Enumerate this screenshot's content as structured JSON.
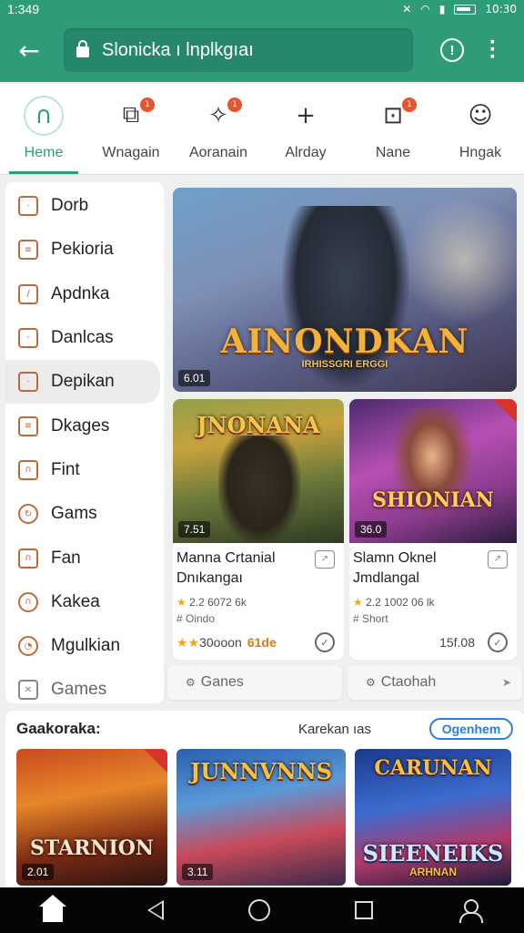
{
  "status_bar": {
    "time_left": "1:349",
    "time_right": "10:30"
  },
  "app_bar": {
    "url_text": "Slonicka ı lnplkgıaı"
  },
  "tabs": [
    {
      "label": "Heme",
      "icon": "headphones-icon",
      "glyph": "∩",
      "badge": ""
    },
    {
      "label": "Wnagain",
      "icon": "pages-icon",
      "glyph": "⧉",
      "badge": "1"
    },
    {
      "label": "Aoranain",
      "icon": "star-icon",
      "glyph": "✧",
      "badge": "1"
    },
    {
      "label": "Alrday",
      "icon": "plus-icon",
      "glyph": "+",
      "badge": ""
    },
    {
      "label": "Nane",
      "icon": "bag-icon",
      "glyph": "⊡",
      "badge": "1"
    },
    {
      "label": "Hngak",
      "icon": "person-icon",
      "glyph": "☺",
      "badge": ""
    }
  ],
  "sidebar": {
    "items": [
      {
        "label": "Dorb",
        "icon": "square-icon",
        "glyph": "·"
      },
      {
        "label": "Pekioria",
        "icon": "layers-icon",
        "glyph": "≡"
      },
      {
        "label": "Apdnka",
        "icon": "pencil-icon",
        "glyph": "/"
      },
      {
        "label": "Danlcas",
        "icon": "smile-icon",
        "glyph": "ᵕ"
      },
      {
        "label": "Depikan",
        "icon": "box-icon",
        "glyph": "·"
      },
      {
        "label": "Dkages",
        "icon": "stack-icon",
        "glyph": "≡"
      },
      {
        "label": "Fint",
        "icon": "lock-icon",
        "glyph": "∩"
      },
      {
        "label": "Gams",
        "icon": "refresh-icon",
        "glyph": "↻"
      },
      {
        "label": "Fan",
        "icon": "bag-icon",
        "glyph": "∩"
      },
      {
        "label": "Kakea",
        "icon": "person-icon",
        "glyph": "∩"
      },
      {
        "label": "Mgulkian",
        "icon": "target-icon",
        "glyph": "◔"
      },
      {
        "label": "Games",
        "icon": "tools-icon",
        "glyph": "✕"
      }
    ]
  },
  "hero": {
    "title": "AINONDKAN",
    "subtitle": "IRHISSGRI ERGGI",
    "tag": "6.01"
  },
  "cards": [
    {
      "tag": "7.51",
      "thumb_title": "JNONANA",
      "title_line1": "Manna Crtanial",
      "title_line2": "Dnıkangaı",
      "rating": "2.2  6072 6k",
      "meta": "# Oindo",
      "stars": "★★",
      "foot_text": "30ooon",
      "price": "61de"
    },
    {
      "tag": "36.0",
      "thumb_title": "SHIONIAN",
      "title_line1": "Slamn Oknel",
      "title_line2": "Jmdlangal",
      "rating": "2.2  1002 06 lk",
      "meta": "# Short",
      "stars": "",
      "foot_text": "15f.08",
      "price": ""
    }
  ],
  "chips": [
    {
      "label": "Ganes",
      "icon": "gamepad-icon"
    },
    {
      "label": "Ctaohah",
      "icon": "gear-icon"
    }
  ],
  "gallery": {
    "title": "Gaakoraka:",
    "subtitle": "Karekan ıas",
    "button": "Ogenhem",
    "tiles": [
      {
        "title": "STARNION",
        "tag": "2.01"
      },
      {
        "title": "JUNNVNNS",
        "tag": "3.11"
      },
      {
        "title": "CARUNAN",
        "title2": "SIEENEIKS",
        "title3": "ARHNAN"
      }
    ]
  }
}
